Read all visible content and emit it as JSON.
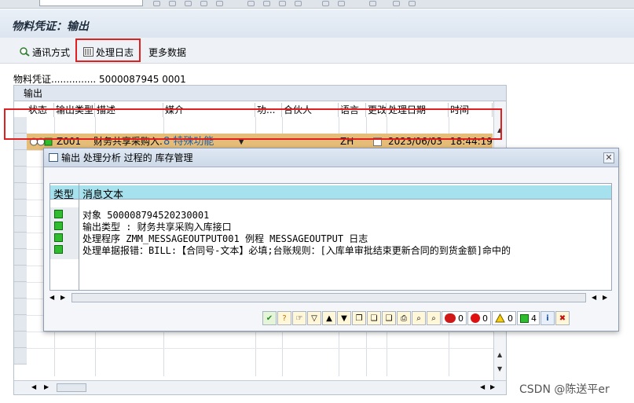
{
  "window": {
    "title": "物料凭证：输出"
  },
  "toolbar": {
    "comm_label": "通讯方式",
    "log_label": "处理日志",
    "more_label": "更多数据"
  },
  "doc": {
    "label": "物料凭证...............",
    "value": "5000087945 0001"
  },
  "output_table": {
    "title": "输出",
    "columns": [
      "状态",
      "输出类型",
      "描述",
      "媒介",
      "功...",
      "合伙人",
      "语言",
      "更改",
      "处理日期",
      "时间"
    ],
    "row": {
      "type": "Z001",
      "desc": "财务共享采购入...",
      "medium_code": "8",
      "medium": "特殊功能",
      "lang": "ZH",
      "date": "2023/06/03",
      "time": "18:44:19"
    }
  },
  "popup": {
    "title": "输出 处理分析 过程的 库存管理",
    "col_type": "类型",
    "col_msg": "消息文本",
    "messages": [
      "对象 500008794520230001",
      "输出类型 : 财务共享采购入库接口",
      "处理程序 ZMM_MESSAGEOUTPUT001 例程 MESSAGEOUTPUT 日志",
      "处理单据报错：BILL:【合同号-文本】必填;台账规则：[入库单审批结束更新合同的到货金额]命中的"
    ],
    "counts": {
      "stop": "0",
      "error": "0",
      "warning": "0",
      "success": "4"
    }
  },
  "watermark": "CSDN @陈送平er"
}
